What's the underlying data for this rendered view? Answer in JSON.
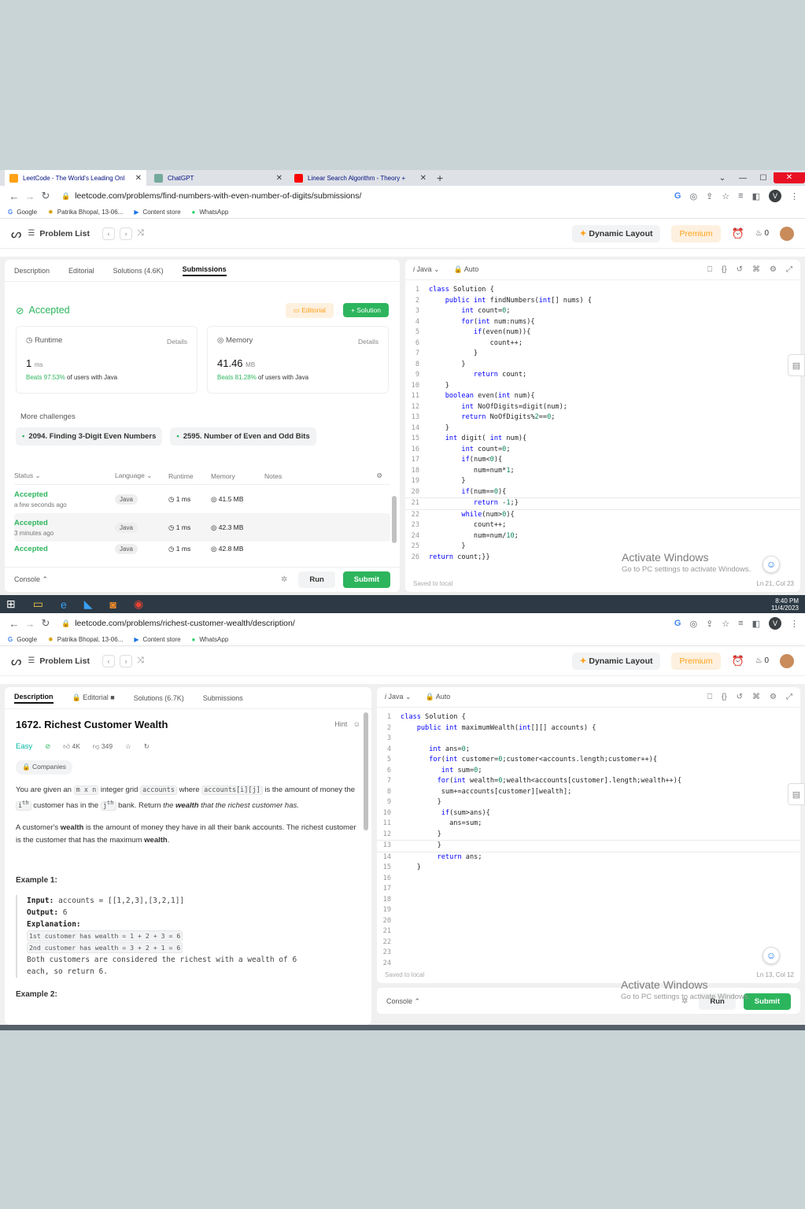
{
  "shot1": {
    "tabs": [
      {
        "title": "LeetCode - The World's Leading Onl"
      },
      {
        "title": "ChatGPT"
      },
      {
        "title": "Linear Search Algorithm - Theory +"
      }
    ],
    "url": "leetcode.com/problems/find-numbers-with-even-number-of-digits/submissions/",
    "profile_initial": "V",
    "bookmarks": [
      "Google",
      "Patrika Bhopal, 13-06...",
      "Content store",
      "WhatsApp"
    ],
    "nav": {
      "problem_list": "Problem List",
      "dynamic_layout": "Dynamic Layout",
      "premium": "Premium",
      "coins": "0"
    },
    "left_tabs": [
      "Description",
      "Editorial",
      "Solutions (4.6K)",
      "Submissions"
    ],
    "status": "Accepted",
    "editorial_btn": "Editorial",
    "solution_btn": "Solution",
    "runtime": {
      "label": "Runtime",
      "details": "Details",
      "value": "1",
      "unit": "ms",
      "beats_pct": "Beats 97.53%",
      "beats_rest": "of users with Java"
    },
    "memory": {
      "label": "Memory",
      "details": "Details",
      "value": "41.46",
      "unit": "MB",
      "beats_pct": "Beats 81.28%",
      "beats_rest": "of users with Java"
    },
    "more_challenges": "More challenges",
    "challenges": [
      "2094. Finding 3-Digit Even Numbers",
      "2595. Number of Even and Odd Bits"
    ],
    "table_headers": [
      "Status",
      "Language",
      "Runtime",
      "Memory",
      "Notes"
    ],
    "submissions": [
      {
        "status": "Accepted",
        "when": "a few seconds ago",
        "lang": "Java",
        "runtime": "1 ms",
        "memory": "41.5 MB"
      },
      {
        "status": "Accepted",
        "when": "3 minutes ago",
        "lang": "Java",
        "runtime": "1 ms",
        "memory": "42.3 MB"
      },
      {
        "status": "Accepted",
        "when": "",
        "lang": "Java",
        "runtime": "1 ms",
        "memory": "42.8 MB"
      }
    ],
    "console": "Console",
    "run": "Run",
    "submit": "Submit",
    "editor_lang": "Java",
    "editor_mode": "Auto",
    "saved": "Saved to local",
    "cursor_pos": "Ln 21, Col 23",
    "code": [
      "class Solution {",
      "    public int findNumbers(int[] nums) {",
      "        int count=0;",
      "        for(int num:nums){",
      "           if(even(num)){",
      "               count++;",
      "           }",
      "        }",
      "           return count;",
      "    }",
      "    boolean even(int num){",
      "        int NoOfDigits=digit(num);",
      "        return NoOfDigits%2==0;",
      "    }",
      "    int digit( int num){",
      "        int count=0;",
      "        if(num<0){",
      "           num=num*1;",
      "        }",
      "        if(num==0){",
      "           return -1;}",
      "        while(num>0){",
      "           count++;",
      "           num=num/10;",
      "        }",
      "return count;}}"
    ],
    "activate_title": "Activate Windows",
    "activate_sub": "Go to PC settings to activate Windows."
  },
  "taskbar": {
    "time": "8:40 PM",
    "date": "11/4/2023"
  },
  "shot2": {
    "url": "leetcode.com/problems/richest-customer-wealth/description/",
    "profile_initial": "V",
    "bookmarks": [
      "Google",
      "Patrika Bhopal, 13-06...",
      "Content store",
      "WhatsApp"
    ],
    "nav": {
      "problem_list": "Problem List",
      "dynamic_layout": "Dynamic Layout",
      "premium": "Premium",
      "coins": "0"
    },
    "left_tabs": [
      "Description",
      "Editorial",
      "Solutions (6.7K)",
      "Submissions"
    ],
    "problem_title": "1672. Richest Customer Wealth",
    "hint": "Hint",
    "difficulty": "Easy",
    "likes": "4K",
    "dislikes": "349",
    "companies": "Companies",
    "desc": {
      "p1_a": "You are given an",
      "mxn": "m x n",
      "p1_b": "integer grid",
      "accounts": "accounts",
      "p1_c": "where",
      "accij": "accounts[i][j]",
      "p1_d": "is the amount of money the",
      "ith": "i",
      "p1_e": "customer has in the",
      "jth": "j",
      "p1_f": "bank. Return",
      "p1_g": "the",
      "wealth": "wealth",
      "p1_h": "that the richest customer has.",
      "p2_a": "A customer's",
      "p2_b": "is the amount of money they have in all their bank accounts. The richest customer is the customer that has the maximum",
      "p2_end": "."
    },
    "example1": {
      "heading": "Example 1:",
      "input_label": "Input:",
      "input": "accounts = [[1,2,3],[3,2,1]]",
      "output_label": "Output:",
      "output": "6",
      "expl_label": "Explanation:",
      "line1": "1st customer has wealth = 1 + 2 + 3 = 6",
      "line2": "2nd customer has wealth = 3 + 2 + 1 = 6",
      "line3": "Both customers are considered the richest with a wealth of 6",
      "line4": "each, so return 6."
    },
    "example2_heading": "Example 2:",
    "editor_lang": "Java",
    "editor_mode": "Auto",
    "saved": "Saved to local",
    "cursor_pos": "Ln 13, Col 12",
    "console": "Console",
    "run": "Run",
    "submit": "Submit",
    "code": [
      "class Solution {",
      "    public int maximumWealth(int[][] accounts) {",
      "",
      "       int ans=0;",
      "       for(int customer=0;customer<accounts.length;customer++){",
      "          int sum=0;",
      "         for(int wealth=0;wealth<accounts[customer].length;wealth++){",
      "          sum+=accounts[customer][wealth];",
      "         }",
      "          if(sum>ans){",
      "            ans=sum;",
      "         }",
      "         }",
      "         return ans;",
      "    }",
      "",
      "",
      "",
      "",
      "",
      "",
      "",
      "",
      ""
    ],
    "activate_title": "Activate Windows",
    "activate_sub": "Go to PC settings to activate Windows."
  }
}
